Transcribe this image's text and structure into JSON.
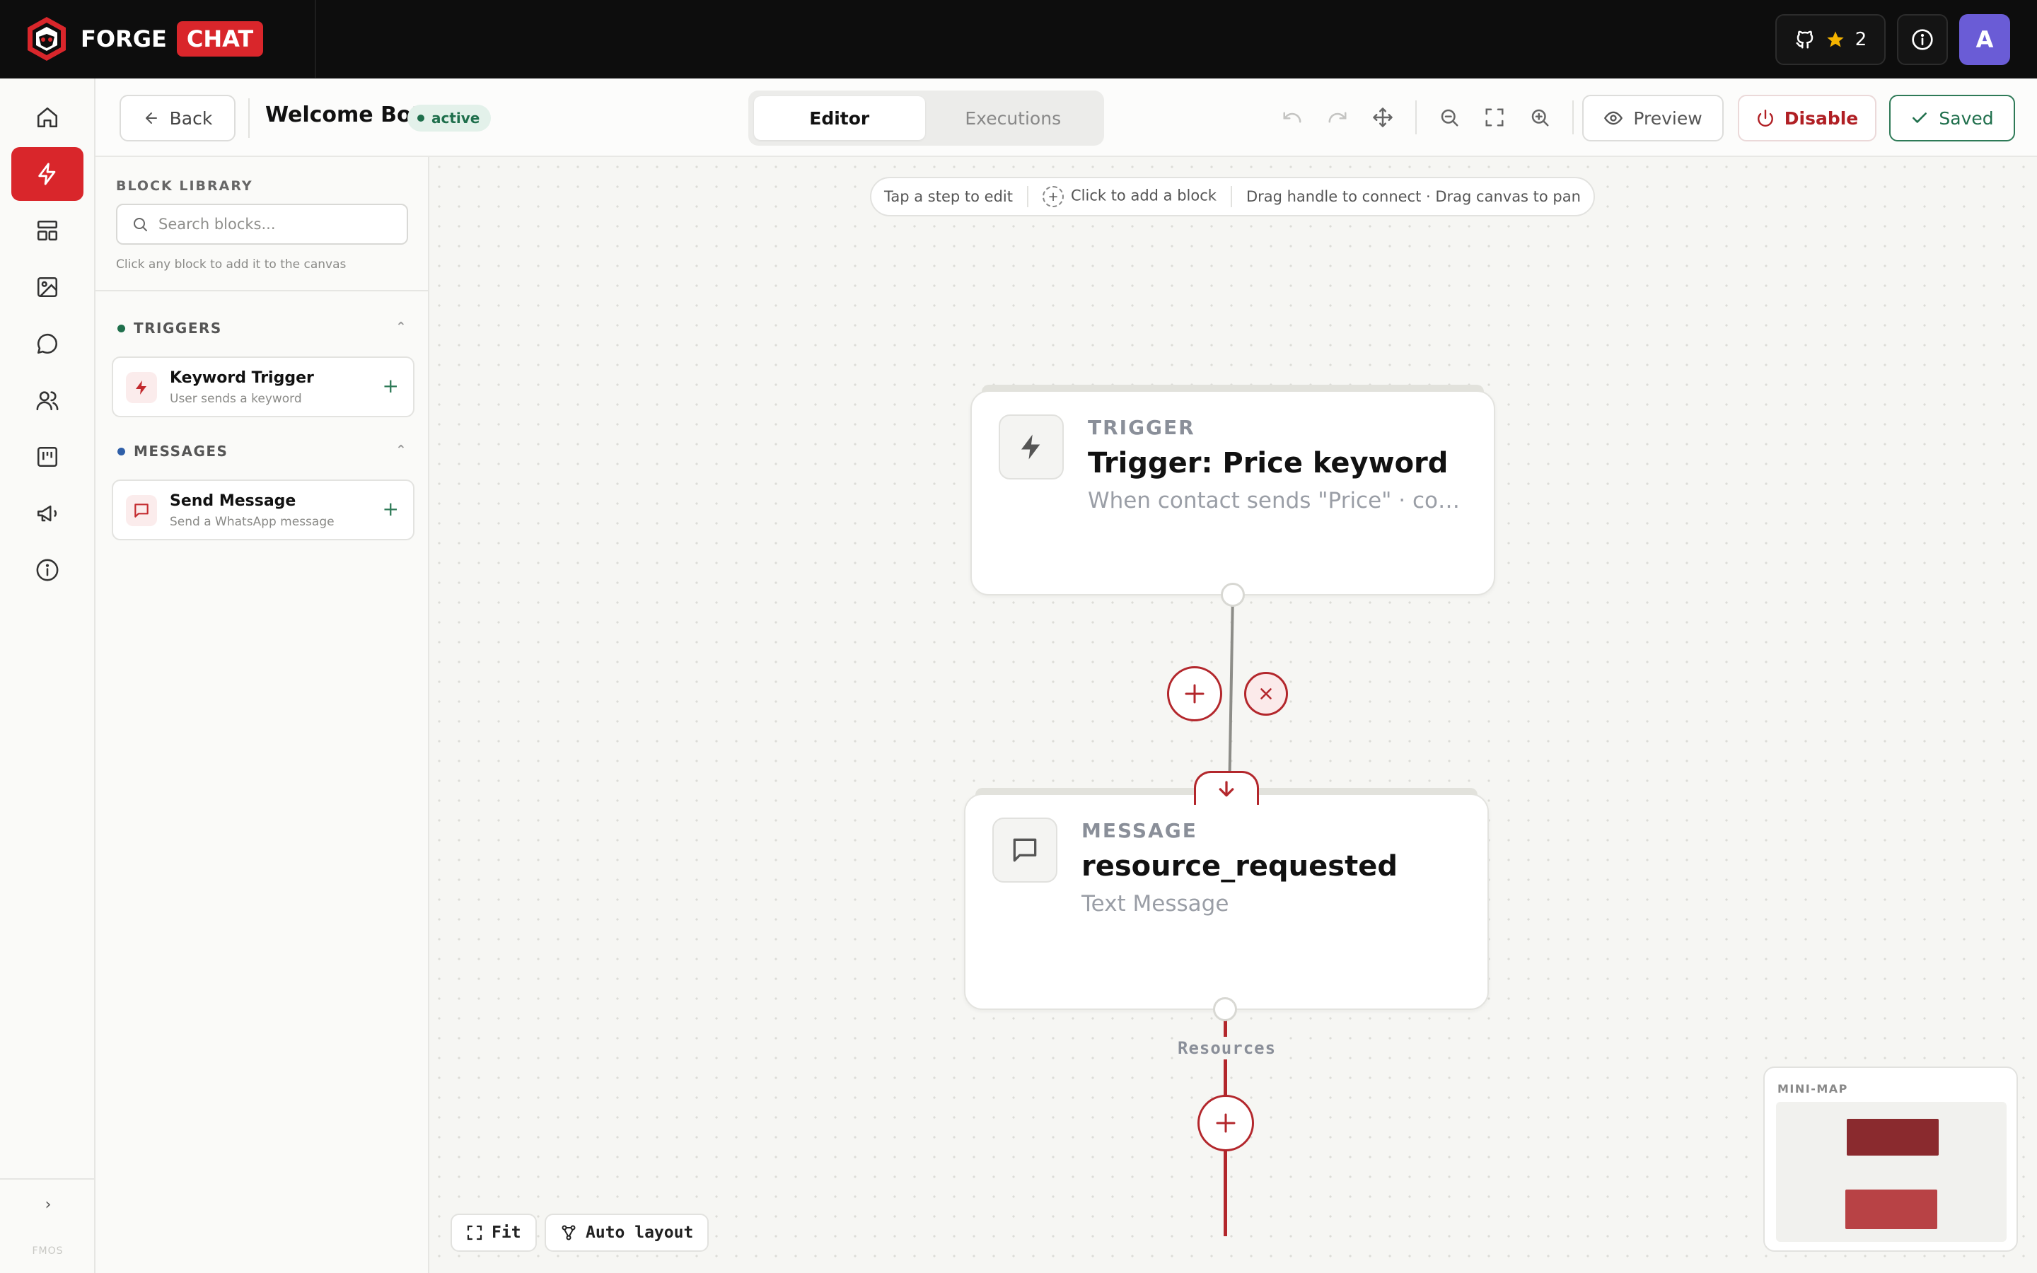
{
  "brand": {
    "forge": "FORGE",
    "chat": "CHAT"
  },
  "topbar": {
    "github_stars": "2",
    "avatar_letter": "A"
  },
  "header": {
    "back_label": "Back",
    "bot_name": "Welcome Bot",
    "status": "active",
    "tabs": [
      {
        "label": "Editor",
        "selected": true
      },
      {
        "label": "Executions",
        "selected": false
      }
    ],
    "preview_label": "Preview",
    "disable_label": "Disable",
    "saved_label": "Saved"
  },
  "library": {
    "title": "BLOCK LIBRARY",
    "search_placeholder": "Search blocks...",
    "hint": "Click any block to add it to the canvas",
    "sections": [
      {
        "title": "TRIGGERS",
        "dot_color": "#1f6f4c",
        "items": [
          {
            "name": "Keyword Trigger",
            "desc": "User sends a keyword",
            "icon": "bolt-icon"
          }
        ]
      },
      {
        "title": "MESSAGES",
        "dot_color": "#2f5fa8",
        "items": [
          {
            "name": "Send Message",
            "desc": "Send a WhatsApp message",
            "icon": "chat-bubble-icon"
          }
        ]
      }
    ]
  },
  "canvas": {
    "hints": [
      "Tap a step to edit",
      "Click to add a block",
      "Drag handle to connect · Drag canvas to pan"
    ],
    "nodes": [
      {
        "type": "TRIGGER",
        "title": "Trigger: Price keyword",
        "subtitle": "When contact sends \"Price\" · contains",
        "icon": "bolt-icon"
      },
      {
        "type": "MESSAGE",
        "title": "resource_requested",
        "subtitle": "Text Message",
        "icon": "chat-bubble-icon"
      }
    ],
    "branch_label": "Resources",
    "fit_label": "Fit",
    "auto_layout_label": "Auto layout",
    "minimap_title": "MINI-MAP"
  },
  "rail": {
    "footer": "FMOS"
  },
  "colors": {
    "brand_red": "#d9262b",
    "accent_green": "#1f6f4c",
    "avatar_purple": "#6a5cd6"
  }
}
